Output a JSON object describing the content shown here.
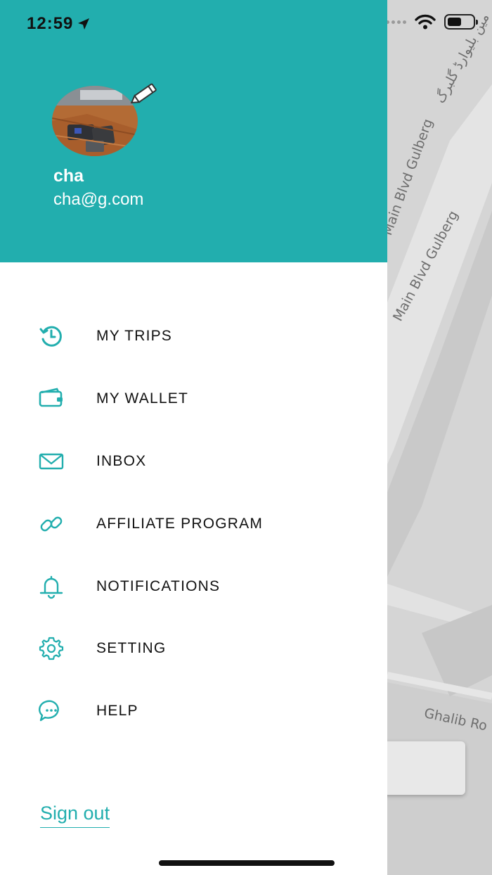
{
  "status_bar": {
    "time": "12:59"
  },
  "profile": {
    "name": "cha",
    "email": "cha@g.com"
  },
  "menu": [
    {
      "label": "MY TRIPS",
      "icon": "history-icon"
    },
    {
      "label": "MY WALLET",
      "icon": "wallet-icon"
    },
    {
      "label": "INBOX",
      "icon": "mail-icon"
    },
    {
      "label": "AFFILIATE PROGRAM",
      "icon": "link-icon"
    },
    {
      "label": "NOTIFICATIONS",
      "icon": "bell-icon"
    },
    {
      "label": "SETTING",
      "icon": "gear-icon"
    },
    {
      "label": "HELP",
      "icon": "chat-icon"
    }
  ],
  "sign_out_label": "Sign out",
  "map": {
    "labels": [
      "Main Blvd Gulberg",
      "Main Blvd Gulberg",
      "Ghalib Ro",
      "مین بلیوارڈ گلبرگ"
    ]
  },
  "colors": {
    "accent": "#22aeae",
    "map_bg": "#d5d5d5"
  }
}
